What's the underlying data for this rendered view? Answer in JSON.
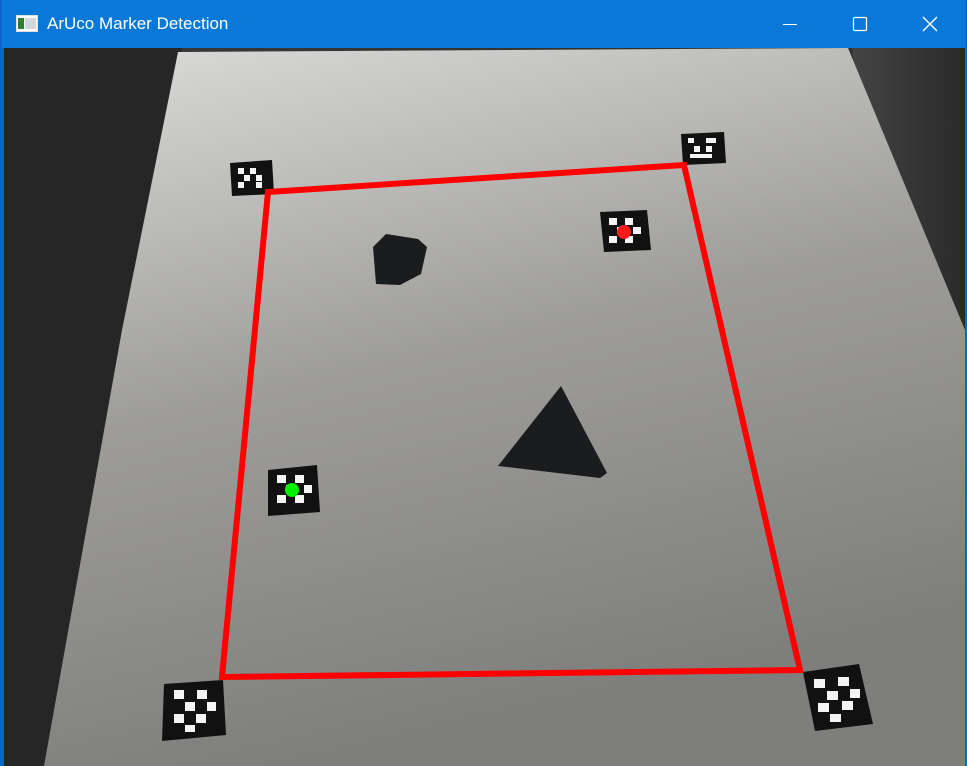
{
  "window": {
    "title": "ArUco Marker Detection",
    "controls": {
      "minimize": "minimize-icon",
      "maximize": "maximize-icon",
      "close": "close-icon"
    }
  },
  "colors": {
    "titlebar": "#0a78d7",
    "region_outline": "#ff0000",
    "marker_point_red": "#ff1a1a",
    "marker_point_green": "#00ee00"
  },
  "scene": {
    "markers": [
      "aruco-marker-top-left",
      "aruco-marker-top-right",
      "aruco-marker-bottom-left",
      "aruco-marker-bottom-right",
      "aruco-marker-inner-red",
      "aruco-marker-inner-green"
    ],
    "shapes": [
      "pentagon-shape",
      "triangle-shape"
    ]
  }
}
